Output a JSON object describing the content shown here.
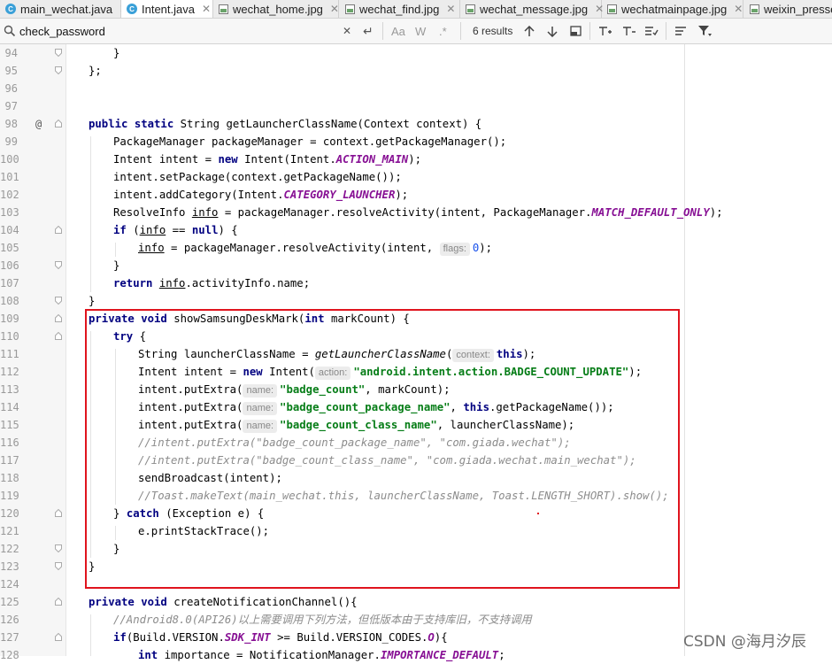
{
  "tabs": [
    {
      "label": "main_wechat.java",
      "icon": "java-class-icon",
      "active": false
    },
    {
      "label": "Intent.java",
      "icon": "java-class-icon",
      "active": true
    },
    {
      "label": "wechat_home.jpg",
      "icon": "image-file-icon",
      "active": false
    },
    {
      "label": "wechat_find.jpg",
      "icon": "image-file-icon",
      "active": false
    },
    {
      "label": "wechat_message.jpg",
      "icon": "image-file-icon",
      "active": false
    },
    {
      "label": "wechatmainpage.jpg",
      "icon": "image-file-icon",
      "active": false
    },
    {
      "label": "weixin_presse",
      "icon": "image-file-icon",
      "active": false
    }
  ],
  "search": {
    "query": "check_password",
    "results": "6 results",
    "match_case": "Aa",
    "words": "W",
    "regex": ".*"
  },
  "lines": [
    "94",
    "95",
    "96",
    "97",
    "98",
    "99",
    "100",
    "101",
    "102",
    "103",
    "104",
    "105",
    "106",
    "107",
    "108",
    "109",
    "110",
    "111",
    "112",
    "113",
    "114",
    "115",
    "116",
    "117",
    "118",
    "119",
    "120",
    "121",
    "122",
    "123",
    "124",
    "125",
    "126",
    "127",
    "128"
  ],
  "code": {
    "l94": "}",
    "l95": "};",
    "l98a": "public static",
    "l98b": " String getLauncherClassName(Context context) {",
    "l99": "PackageManager packageManager = context.getPackageManager();",
    "l100a": "Intent intent = ",
    "l100b": "new",
    "l100c": " Intent(Intent.",
    "l100d": "ACTION_MAIN",
    "l100e": ");",
    "l101": "intent.setPackage(context.getPackageName());",
    "l102a": "intent.addCategory(Intent.",
    "l102b": "CATEGORY_LAUNCHER",
    "l102c": ");",
    "l103a": "ResolveInfo ",
    "l103b": "info",
    "l103c": " = packageManager.resolveActivity(intent, PackageManager.",
    "l103d": "MATCH_DEFAULT_ONLY",
    "l103e": ");",
    "l104a": "if",
    "l104b": " (",
    "l104c": "info",
    "l104d": " == ",
    "l104e": "null",
    "l104f": ") {",
    "l105a": "info",
    "l105b": " = packageManager.resolveActivity(intent, ",
    "l105hint": "flags:",
    "l105c": "0",
    "l105d": ");",
    "l106": "}",
    "l107a": "return",
    "l107b": " ",
    "l107c": "info",
    "l107d": ".activityInfo.name;",
    "l108": "}",
    "l109a": "private void",
    "l109b": " showSamsungDeskMark(",
    "l109c": "int",
    "l109d": " markCount) {",
    "l110a": "try",
    "l110b": " {",
    "l111a": "String launcherClassName = ",
    "l111b": "getLauncherClassName",
    "l111c": "(",
    "l111hint": "context:",
    "l111d": "this",
    "l111e": ");",
    "l112a": "Intent intent = ",
    "l112b": "new",
    "l112c": " Intent(",
    "l112hint": "action:",
    "l112d": "\"android.intent.action.BADGE_COUNT_UPDATE\"",
    "l112e": ");",
    "l113a": "intent.putExtra(",
    "l113hint": "name:",
    "l113b": "\"badge_count\"",
    "l113c": ", markCount);",
    "l114a": "intent.putExtra(",
    "l114hint": "name:",
    "l114b": "\"badge_count_package_name\"",
    "l114c": ", ",
    "l114d": "this",
    "l114e": ".getPackageName());",
    "l115a": "intent.putExtra(",
    "l115hint": "name:",
    "l115b": "\"badge_count_class_name\"",
    "l115c": ", launcherClassName);",
    "l116": "//intent.putExtra(\"badge_count_package_name\", \"com.giada.wechat\");",
    "l117": "//intent.putExtra(\"badge_count_class_name\", \"com.giada.wechat.main_wechat\");",
    "l118": "sendBroadcast(intent);",
    "l119": "//Toast.makeText(main_wechat.this, launcherClassName, Toast.LENGTH_SHORT).show();",
    "l120a": "} ",
    "l120b": "catch",
    "l120c": " (Exception e) {",
    "l121": "e.printStackTrace();",
    "l122": "}",
    "l123": "}",
    "l125a": "private void",
    "l125b": " createNotificationChannel(){",
    "l126": "//Android8.0(API26)以上需要调用下列方法，但低版本由于支持库旧，不支持调用",
    "l127a": "if",
    "l127b": "(Build.VERSION.",
    "l127c": "SDK_INT",
    "l127d": " >= Build.VERSION_CODES.",
    "l127e": "O",
    "l127f": "){",
    "l128a": "int",
    "l128b": " importance = NotificationManager.",
    "l128c": "IMPORTANCE_DEFAULT",
    "l128d": ";"
  },
  "watermark": "CSDN @海月汐辰",
  "colors": {
    "keyword": "#000080",
    "string": "#067d17",
    "constant": "#871094",
    "comment": "#8c8c8c",
    "highlight_box": "#e0141e"
  }
}
